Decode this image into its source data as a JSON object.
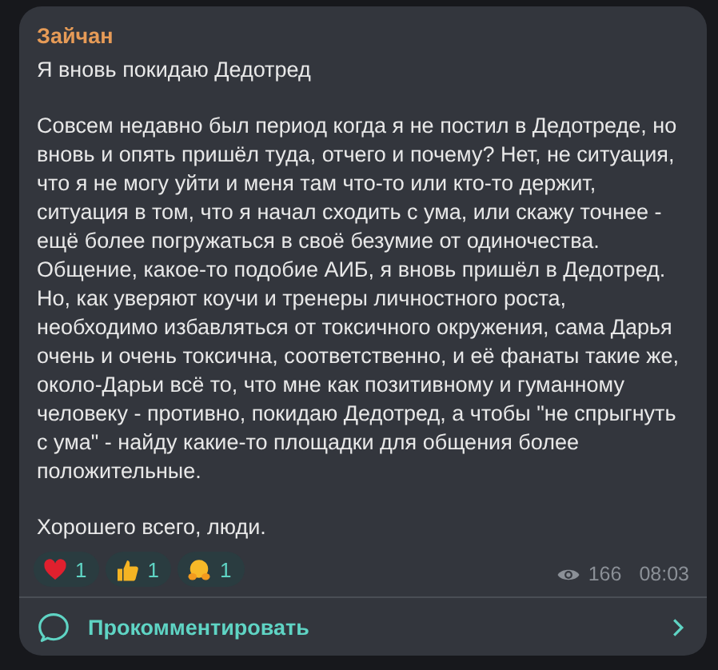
{
  "message": {
    "author": "Зайчан",
    "title": "Я вновь покидаю Дедотред",
    "paragraphs": [
      "Совсем недавно был период когда я не постил в Дедотреде, но\nвновь и опять пришёл туда, отчего и почему? Нет, не ситуация,\nчто я не могу уйти и меня там что-то или кто-то держит,\nситуация в том, что я начал сходить с ума, или скажу точнее -\nещё более погружаться в своё безумие от одиночества.\nОбщение, какое-то подобие АИБ, я вновь пришёл в Дедотред.\nНо, как уверяют коучи и тренеры личностного роста,\nнеобходимо избавляться от токсичного окружения, сама Дарья\nочень и очень токсична, соответственно, и её фанаты такие же,\nоколо-Дарьи всё то, что мне как позитивному и гуманному\nчеловеку - противно, покидаю Дедотред, а чтобы \"не спрыгнуть\nс ума\" - найду какие-то площадки для общения более\nположительные.",
      "Хорошего всего, люди."
    ],
    "reactions": [
      {
        "kind": "heart",
        "count": "1"
      },
      {
        "kind": "thumbs_up",
        "count": "1"
      },
      {
        "kind": "hug",
        "count": "1"
      }
    ],
    "views": "166",
    "time": "08:03"
  },
  "comment_button": {
    "label": "Прокомментировать"
  }
}
